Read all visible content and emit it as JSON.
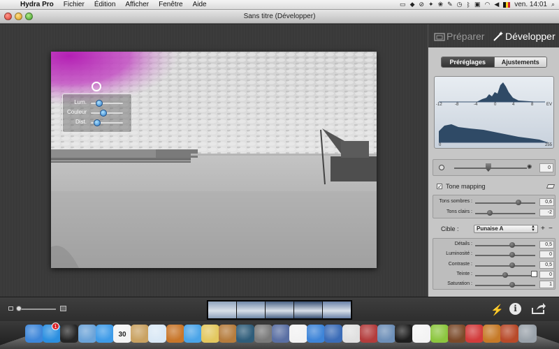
{
  "menubar": {
    "apple_symbol": "",
    "app_name": "Hydra Pro",
    "menus": [
      "Fichier",
      "Édition",
      "Afficher",
      "Fenêtre",
      "Aide"
    ],
    "clock": "ven. 14:01",
    "status_icons": [
      "finder-icon",
      "dropbox-icon",
      "do-not-disturb-icon",
      "growl-icon",
      "paw-icon",
      "evernote-icon",
      "time-machine-icon",
      "bluetooth-icon",
      "display-icon",
      "wifi-icon",
      "volume-icon",
      "flag-belgium-icon",
      "spotlight-icon"
    ],
    "flag_colors": [
      "#111111",
      "#f4d21f",
      "#d3232c"
    ]
  },
  "window": {
    "title": "Sans titre (Développer)"
  },
  "overlay": {
    "sliders": [
      {
        "label": "Lum.",
        "level": 0.25
      },
      {
        "label": "Couleur",
        "level": 0.4
      },
      {
        "label": "Dist.",
        "level": 0.2
      }
    ]
  },
  "mode_tabs": {
    "prepare": "Préparer",
    "develop": "Développer"
  },
  "segmented": {
    "presets": "Préréglages",
    "adjustments": "Ajustements"
  },
  "histogram": {
    "top_ticks": [
      "-12",
      "-8",
      "-4",
      "0",
      "4",
      "8",
      "EV"
    ],
    "bottom_ticks": [
      "0",
      "255"
    ]
  },
  "exposure": {
    "value": "0",
    "level": 0.47
  },
  "tone_mapping": {
    "checked": "✓",
    "label": "Tone mapping",
    "sliders": [
      {
        "label": "Tons sombres :",
        "value": "0,6",
        "level": 0.72
      },
      {
        "label": "Tons clairs :",
        "value": "-2",
        "level": 0.24
      }
    ]
  },
  "target": {
    "label": "Cible :",
    "selected": "Punaise A",
    "add_symbol": "+",
    "remove_symbol": "−"
  },
  "details": {
    "sliders": [
      {
        "label": "Détails :",
        "value": "0,5",
        "level": 0.62
      },
      {
        "label": "Luminosité :",
        "value": "0",
        "level": 0.62
      },
      {
        "label": "Contraste :",
        "value": "0,5",
        "level": 0.62
      },
      {
        "label": "Teinte :",
        "value": "0",
        "level": 0.5
      },
      {
        "label": "Saturation :",
        "value": "1",
        "level": 0.62
      }
    ]
  },
  "bottombar": {
    "info_symbol": "i",
    "bolt_symbol": "⚡",
    "filmstrip_colors": [
      "#8fa3bd",
      "#6f88a8",
      "#4d6588",
      "#3a5275",
      "#6a82a8"
    ]
  },
  "dock": {
    "calendar_date": "30",
    "mail_badge": "1",
    "apps": [
      {
        "name": "finder-icon",
        "color": "#3d86d9"
      },
      {
        "name": "app-store-icon",
        "color": "#2b8fe0"
      },
      {
        "name": "dashboard-icon",
        "color": "#262626"
      },
      {
        "name": "mail-icon",
        "color": "#6ba3d8"
      },
      {
        "name": "safari-icon",
        "color": "#3e9be8"
      },
      {
        "name": "calendar-icon",
        "color": "#f4f4f4"
      },
      {
        "name": "notebook-icon",
        "color": "#c9a262"
      },
      {
        "name": "preview-icon",
        "color": "#d9e8f5"
      },
      {
        "name": "photos-icon",
        "color": "#c8762a"
      },
      {
        "name": "itunes-icon",
        "color": "#4aa4e8"
      },
      {
        "name": "imovie-icon",
        "color": "#e3c860"
      },
      {
        "name": "garageband-icon",
        "color": "#b57c3d"
      },
      {
        "name": "time-machine-icon",
        "color": "#2f5d7a"
      },
      {
        "name": "screenshot-icon",
        "color": "#7a7a7a"
      },
      {
        "name": "xcode-icon",
        "color": "#5a6fa3"
      },
      {
        "name": "textedit-icon",
        "color": "#f2f2f2"
      },
      {
        "name": "pages-icon",
        "color": "#3d84d8"
      },
      {
        "name": "network-icon",
        "color": "#3b6cb7"
      },
      {
        "name": "keynote-icon",
        "color": "#e0e0e0"
      },
      {
        "name": "photo-booth-icon",
        "color": "#b33c3c"
      },
      {
        "name": "iphoto-icon",
        "color": "#6d8fb8"
      },
      {
        "name": "terminal-icon",
        "color": "#1e1e1e"
      },
      {
        "name": "cow-icon",
        "color": "#f3f3f3"
      },
      {
        "name": "drink-icon",
        "color": "#8cc63f"
      },
      {
        "name": "coffee-icon",
        "color": "#7b4a2a"
      },
      {
        "name": "magnet-icon",
        "color": "#d23b3b"
      },
      {
        "name": "lock-icon",
        "color": "#c67a28"
      },
      {
        "name": "reel-icon",
        "color": "#b84a2a"
      },
      {
        "name": "trash-icon",
        "color": "#9aa2aa"
      }
    ]
  }
}
